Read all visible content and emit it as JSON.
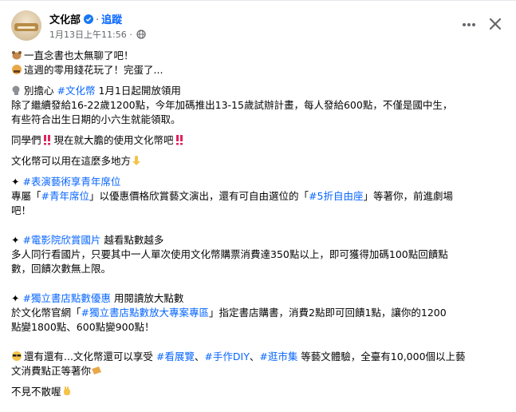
{
  "header": {
    "page_name": "文化部",
    "separator": "·",
    "follow_label": "追蹤",
    "timestamp": "1月13日上午11:56",
    "meta_separator": "·"
  },
  "post": {
    "line1": "一直念書也太無聊了吧！",
    "line2": "這週的零用錢花玩了！完蛋了...",
    "line3_prefix": "別擔心 ",
    "line3_tag": "#文化幣",
    "line3_suffix": " 1月1日起開放領用",
    "line4": "除了繼續發給16-22歲1200點，今年加碼推出13-15歲試辦計畫，每人發給600點，不僅是國中生，",
    "line5": "有些符合出生日期的小六生就能領取。",
    "line6": "同學們",
    "line6b": "現在就大膽的使用文化幣吧",
    "line7": "文化幣可以用在這麼多地方",
    "sec1_bullet": "✦ ",
    "sec1_tag": "#表演藝術享青年席位",
    "sec1_l1a": "專屬「",
    "sec1_l1tag": "#青年席位",
    "sec1_l1b": "」以優惠價格欣賞藝文演出，還有可自由選位的「",
    "sec1_l1tag2": "#5折自由座",
    "sec1_l1c": "」等著你，前進劇場",
    "sec1_l2": "吧！",
    "sec2_bullet": "✦ ",
    "sec2_tag": "#電影院欣賞國片",
    "sec2_suffix": " 越看點數越多",
    "sec2_l1": "多人同行看國片，只要其中一人單次使用文化幣購票消費達350點以上，即可獲得加碼100點回饋點",
    "sec2_l2": "數，回饋次數無上限。",
    "sec3_bullet": "✦ ",
    "sec3_tag": "#獨立書店點數優惠",
    "sec3_suffix": " 用閱讀放大點數",
    "sec3_l1a": "於文化幣官網「",
    "sec3_l1tag": "#獨立書店點數放大專案專區",
    "sec3_l1b": "」指定書店購書，消費2點即可回饋1點，讓你的1200",
    "sec3_l2": "點變1800點、600點變900點！",
    "final_l1a": "還有還有...文化幣還可以享受 ",
    "final_tag1": "#看展覽",
    "final_sep1": "、",
    "final_tag2": "#手作DIY",
    "final_sep2": "、",
    "final_tag3": "#逛市集",
    "final_l1b": " 等藝文體驗，全臺有10,000個以上藝",
    "final_l2": "文消費點正等著你",
    "final_line": "不見不散喔"
  },
  "icons": {
    "avatar": "culture-ministry-logo",
    "verified": "verified-badge-icon",
    "globe": "globe-icon",
    "more": "more-options-icon",
    "close": "close-icon"
  },
  "colors": {
    "link": "#0866ff",
    "verified": "#1877f2",
    "muted": "#65676b",
    "text": "#050505"
  }
}
